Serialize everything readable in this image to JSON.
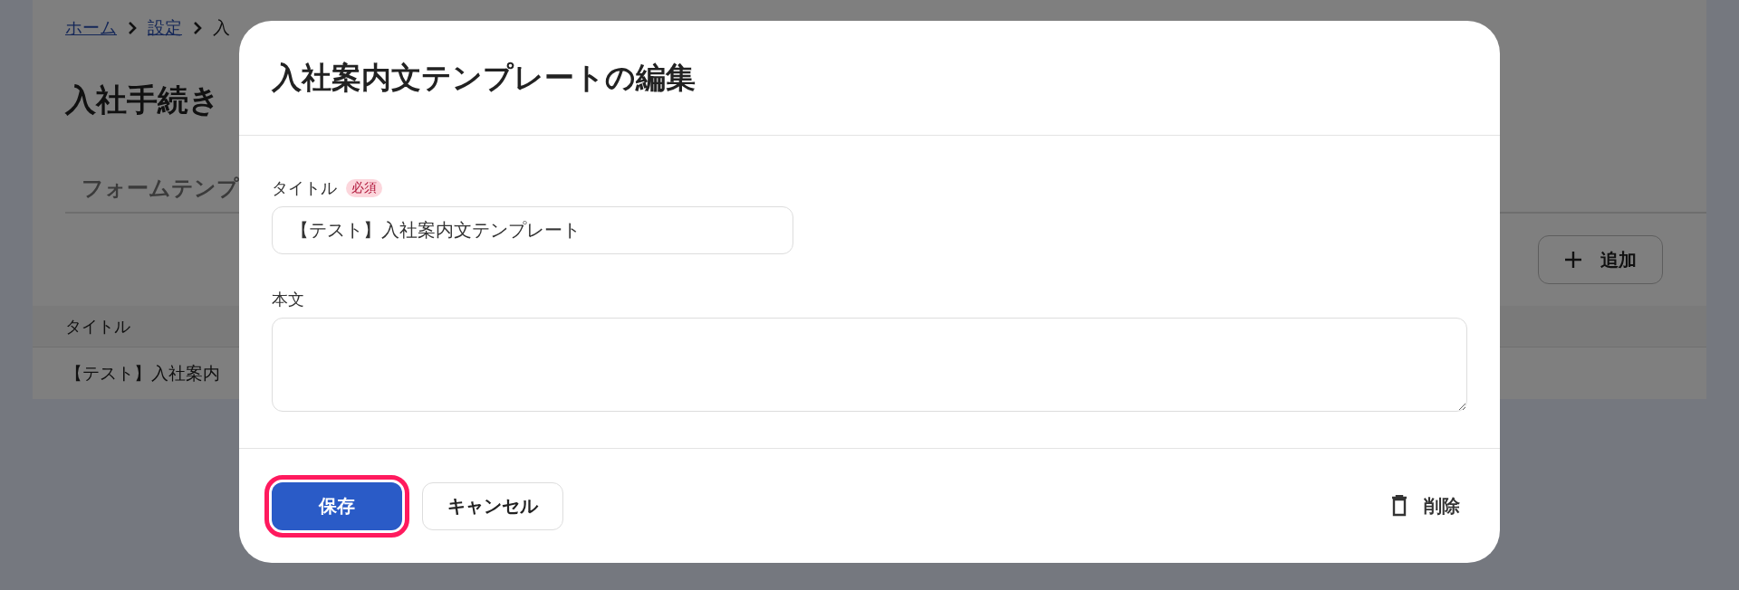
{
  "breadcrumb": [
    {
      "label": "ホーム",
      "link": true
    },
    {
      "label": "設定",
      "link": true
    },
    {
      "label": "入",
      "link": false
    }
  ],
  "page_title": "入社手続き",
  "tabs": [
    {
      "label": "フォームテンプ"
    }
  ],
  "add_button": {
    "label": "追加"
  },
  "table": {
    "columns": [
      "タイトル"
    ],
    "rows": [
      [
        "【テスト】入社案内"
      ]
    ]
  },
  "modal": {
    "title": "入社案内文テンプレートの編集",
    "fields": [
      {
        "kind": "text",
        "label": "タイトル",
        "badge": "必須",
        "value": "【テスト】入社案内文テンプレート"
      },
      {
        "kind": "textarea",
        "label": "本文"
      }
    ],
    "buttons": [
      {
        "kind": "primary",
        "label": "保存",
        "highlighted": true
      },
      {
        "kind": "secondary",
        "label": "キャンセル",
        "highlighted": false
      },
      {
        "kind": "delete",
        "label": "削除",
        "highlighted": false
      }
    ]
  }
}
